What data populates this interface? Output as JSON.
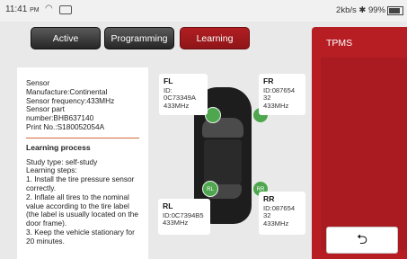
{
  "status": {
    "time": "11:41",
    "ampm": "PM",
    "right_text": "2kb/s ✱ 99%"
  },
  "tabs": [
    {
      "label": "Active"
    },
    {
      "label": "Programming"
    },
    {
      "label": "Learning"
    }
  ],
  "info": {
    "sensor_label": "Sensor",
    "manufacturer": "Manufacture:Continental",
    "frequency": "Sensor frequency:433MHz",
    "part_label": "Sensor part",
    "part_number": "number:BHB637140",
    "print_no": "Print No.:S180052054A",
    "learning_title": "Learning process",
    "study_type": "Study type: self-study",
    "steps_label": "Learning steps:",
    "step1": "1. Install the tire pressure sensor correctly.",
    "step2": "2. Inflate all tires to the nominal value according to the tire label (the label is usually located on the door frame).",
    "step3": "3. Keep the vehicle stationary for 20 minutes."
  },
  "wheels": {
    "fl": {
      "pos": "FL",
      "id_label": "ID:",
      "id_value": "0C73349A",
      "freq": "433MHz",
      "dot": ""
    },
    "fr": {
      "pos": "FR",
      "id_label": "ID:087654",
      "id_value": "32",
      "freq": "433MHz",
      "dot": ""
    },
    "rl": {
      "pos": "RL",
      "id_label": "ID:0C7394B5",
      "id_value": "",
      "freq": "433MHz",
      "dot": "RL"
    },
    "rr": {
      "pos": "RR",
      "id_label": "ID:087654",
      "id_value": "32",
      "freq": "433MHz",
      "dot": "RR"
    }
  },
  "panel": {
    "title": "TPMS"
  },
  "back": {
    "icon": "back-arrow-icon",
    "glyph": "⮌"
  },
  "colors": {
    "accent": "#b61e24",
    "sensor_green": "#4ea64e"
  }
}
